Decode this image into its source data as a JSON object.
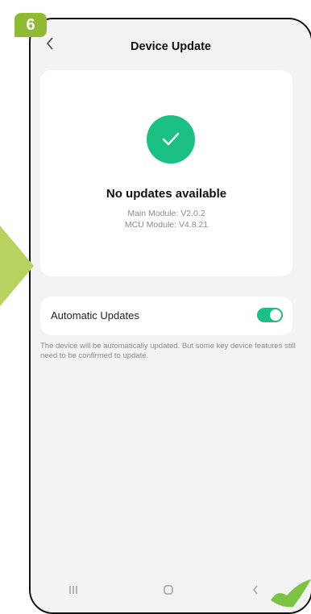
{
  "step_badge": "6",
  "header": {
    "title": "Device Update"
  },
  "status": {
    "title": "No updates available",
    "main_module": "Main Module: V2.0.2",
    "mcu_module": "MCU Module: V4.8.21"
  },
  "automatic_updates": {
    "label": "Automatic Updates",
    "enabled": true,
    "description": "The device will be automatically updated. But some key device features still need to be confirmed to update."
  },
  "colors": {
    "accent": "#1abf84",
    "badge": "#8fba33",
    "arrow": "#b6d35f"
  }
}
